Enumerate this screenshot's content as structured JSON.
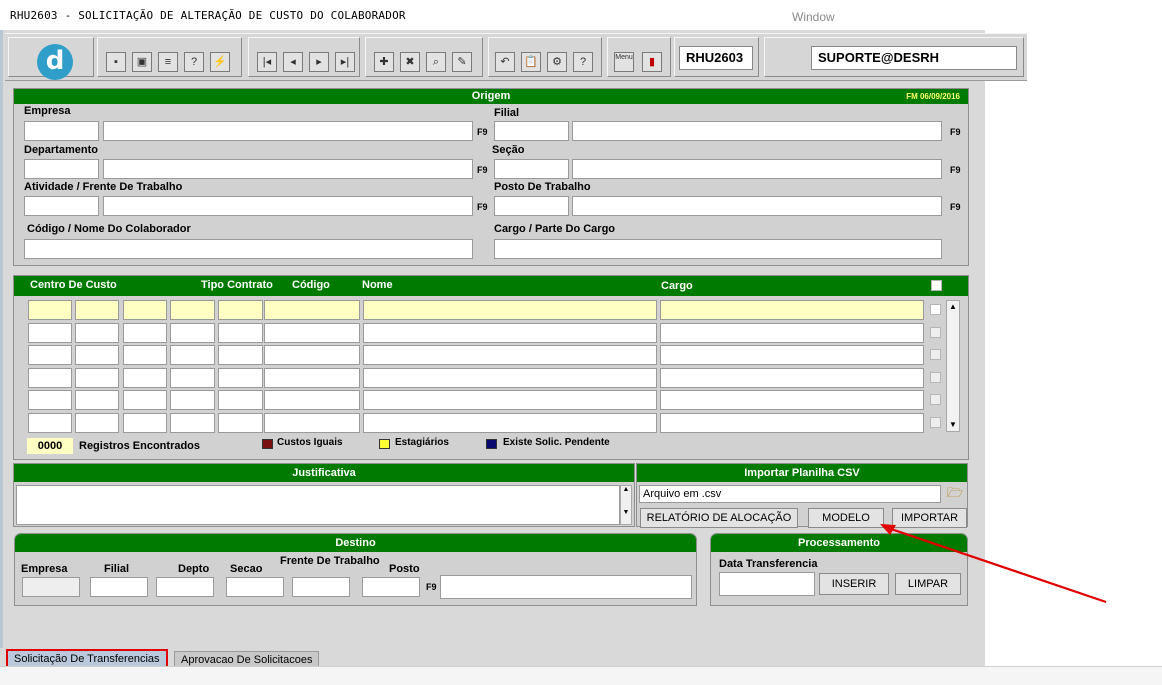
{
  "window": {
    "title": "RHU2603 - SOLICITAÇÃO DE ALTERAÇÃO DE CUSTO DO COLABORADOR",
    "window_label": "Window"
  },
  "toolbar": {
    "logo": "d",
    "module_code": "RHU2603",
    "user": "SUPORTE@DESRH",
    "menu_icon_label": "Menu"
  },
  "origem": {
    "title": "Origem",
    "fm_date": "FM 06/09/2016",
    "labels": {
      "empresa": "Empresa",
      "filial": "Filial",
      "departamento": "Departamento",
      "secao": "Seção",
      "atividade": "Atividade / Frente De Trabalho",
      "posto": "Posto De Trabalho",
      "colaborador": "Código / Nome  Do Colaborador",
      "cargo": "Cargo / Parte Do Cargo"
    },
    "f9": "F9"
  },
  "grid": {
    "columns": [
      "Centro De Custo",
      "Tipo Contrato",
      "Código",
      "Nome",
      "Cargo"
    ],
    "rows": 6,
    "records_count": "0000",
    "records_label": "Registros Encontrados",
    "legend": [
      {
        "label": "Custos Iguais",
        "color": "#7a0f0f"
      },
      {
        "label": "Estagiários",
        "color": "#ffff33"
      },
      {
        "label": "Existe Solic. Pendente",
        "color": "#0a0a6e"
      }
    ]
  },
  "justificativa": {
    "title": "Justificativa",
    "value": ""
  },
  "importar": {
    "title": "Importar Planilha CSV",
    "file_value": "Arquivo em .csv",
    "btn_relatorio": "RELATÓRIO DE ALOCAÇÃO",
    "btn_modelo": "MODELO",
    "btn_importar": "IMPORTAR"
  },
  "destino": {
    "title": "Destino",
    "labels": {
      "empresa": "Empresa",
      "filial": "Filial",
      "depto": "Depto",
      "secao": "Secao",
      "frente": "Frente De Trabalho",
      "posto": "Posto"
    },
    "f9": "F9"
  },
  "processamento": {
    "title": "Processamento",
    "data_label": "Data Transferencia",
    "btn_inserir": "INSERIR",
    "btn_limpar": "LIMPAR"
  },
  "tabs": [
    {
      "label": "Solicitação De Transferencias",
      "active": true
    },
    {
      "label": "Aprovacao De Solicitacoes",
      "active": false
    }
  ],
  "colors": {
    "header_green": "#007a00",
    "annotation_red": "#e00000",
    "panel_gray": "#d1d1d1"
  }
}
